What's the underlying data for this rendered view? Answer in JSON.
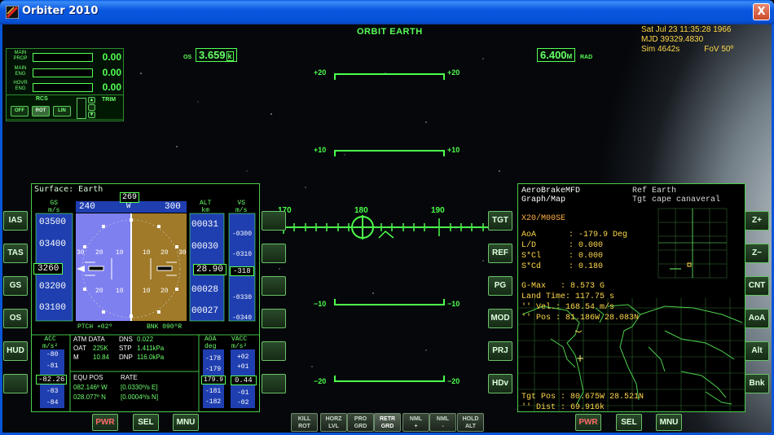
{
  "window": {
    "title": "Orbiter 2010",
    "close_glyph": "X"
  },
  "hud": {
    "mode": "ORBIT EARTH",
    "os_label": "OS",
    "os_value": "3.659",
    "os_unit": "k",
    "rad_value": "6.400",
    "rad_unit_m": "M",
    "rad_label": "RAD",
    "date": "Sat Jul 23 11:35:28 1966",
    "mjd": "MJD 39329.4830",
    "sim": "Sim  4642s",
    "fov": "FoV  50º",
    "pitch_labels": {
      "p20": "+20",
      "p10": "+10",
      "m10": "−10",
      "m20": "−20"
    },
    "heading_labels": {
      "h170": "170",
      "h180": "180",
      "h190": "190"
    }
  },
  "engines": {
    "main_prop_label": [
      "MAIN",
      "PROP"
    ],
    "main_eng_label": [
      "MAIN",
      "ENG"
    ],
    "hovr_eng_label": [
      "HOVR",
      "ENG"
    ],
    "main_prop": "0.00",
    "main_eng": "0.00",
    "hovr_eng": "0.00",
    "rcs_label": "RCS",
    "trim_label": "TRIM",
    "rcs_off": "OFF",
    "rcs_rot": "ROT",
    "rcs_lin": "LIN"
  },
  "left_buttons": [
    "IAS",
    "TAS",
    "GS",
    "OS",
    "HUD",
    ""
  ],
  "left_mfd_right_buttons": [
    "",
    "",
    "",
    "",
    "",
    ""
  ],
  "right_mfd_left_buttons": [
    "TGT",
    "REF",
    "PG",
    "MOD",
    "PRJ",
    "HDv"
  ],
  "right_buttons": [
    "Z+",
    "Z−",
    "CNT",
    "AoA",
    "Alt",
    "Bnk"
  ],
  "left_mfd_bottom": [
    "PWR",
    "SEL",
    "MNU"
  ],
  "right_mfd_bottom": [
    "PWR",
    "SEL",
    "MNU"
  ],
  "nav_modes": [
    [
      "KILL",
      "ROT"
    ],
    [
      "HORZ",
      "LVL"
    ],
    [
      "PRO",
      "GRD"
    ],
    [
      "RETR",
      "GRD"
    ],
    [
      "NML",
      "+"
    ],
    [
      "NML",
      "-"
    ],
    [
      "HOLD",
      "ALT"
    ]
  ],
  "surface_mfd": {
    "title": "Surface: Earth",
    "gs_label": "GS",
    "gs_unit": "m/s",
    "alt_label": "ALT",
    "alt_unit": "km",
    "vs_label": "VS",
    "vs_unit": "m/s",
    "gs_ticks": [
      "03500",
      "03400",
      "03200",
      "03100"
    ],
    "gs_value": "3260",
    "heading_value": "269",
    "heading_ticks": [
      "240",
      "W",
      "300"
    ],
    "alt_ticks": [
      "00031",
      "00030",
      "00028",
      "00027"
    ],
    "alt_value": "28.90",
    "vs_ticks": [
      "-0300",
      "-0310",
      "-0330",
      "-0340"
    ],
    "vs_value": "-318",
    "ptch": "PTCH +02º",
    "bnk": "BNK 090ºR",
    "adi_labels": [
      "30",
      "20",
      "10",
      "10",
      "20",
      "30",
      "20",
      "10",
      "10",
      "20"
    ],
    "acc_label": "ACC",
    "acc_unit": "m/s²",
    "acc_ticks": [
      "-80",
      "-81",
      "-83",
      "-84"
    ],
    "acc_value": "-82.26",
    "atm_label": "ATM DATA",
    "oat_label": "OAT",
    "oat": "225K",
    "m_label": "M",
    "mach": "10.84",
    "dns_label": "DNS",
    "dns": "0.022",
    "stp_label": "STP",
    "stp": "1.411kPa",
    "dnp_label": "DNP",
    "dnp": "116.0kPa",
    "equ_label": "EQU POS",
    "lon": "082.146º W",
    "lat": "028.077º N",
    "rate_label": "RATE",
    "rate_lon": "[0.0330º/s E]",
    "rate_lat": "[0.0004º/s N]",
    "aoa_label": "AOA",
    "aoa_unit": "deg",
    "aoa_ticks": [
      "-178",
      "-179",
      "-181",
      "-182"
    ],
    "aoa_value": "179.9",
    "vacc_label": "VACC",
    "vacc_unit": "m/s²",
    "vacc_ticks": [
      "+02",
      "+01",
      "-01",
      "-02"
    ],
    "vacc_value": "0.44"
  },
  "aero_mfd": {
    "title1": "AeroBrakeMFD",
    "title2": "Graph/Map",
    "ref": "Ref Earth",
    "tgt": "Tgt cape canaveral",
    "vehicle": "X20/M00SE",
    "aoa_label": "AoA",
    "aoa": ": -179.9 Deg",
    "ld_label": "L/D",
    "ld": ":  0.000",
    "scl_label": "S*Cl",
    "scl": ":  0.000",
    "scd_label": "S*Cd",
    "scd": ":  0.180",
    "gmax_label": "G-Max",
    "gmax": ":  8.573 G",
    "land_label": "Land Time:",
    "land": "117.75 s",
    "vel_label": "''  Vel.:",
    "vel": "168.54 m/s",
    "pos_label": "''  Pos :",
    "pos": "81.186W  28.083N",
    "tgtpos_label": "Tgt Pos  :",
    "tgtpos": "80.675W  28.521N",
    "dist_label": "''  Dist :",
    "dist": "69.916k"
  }
}
